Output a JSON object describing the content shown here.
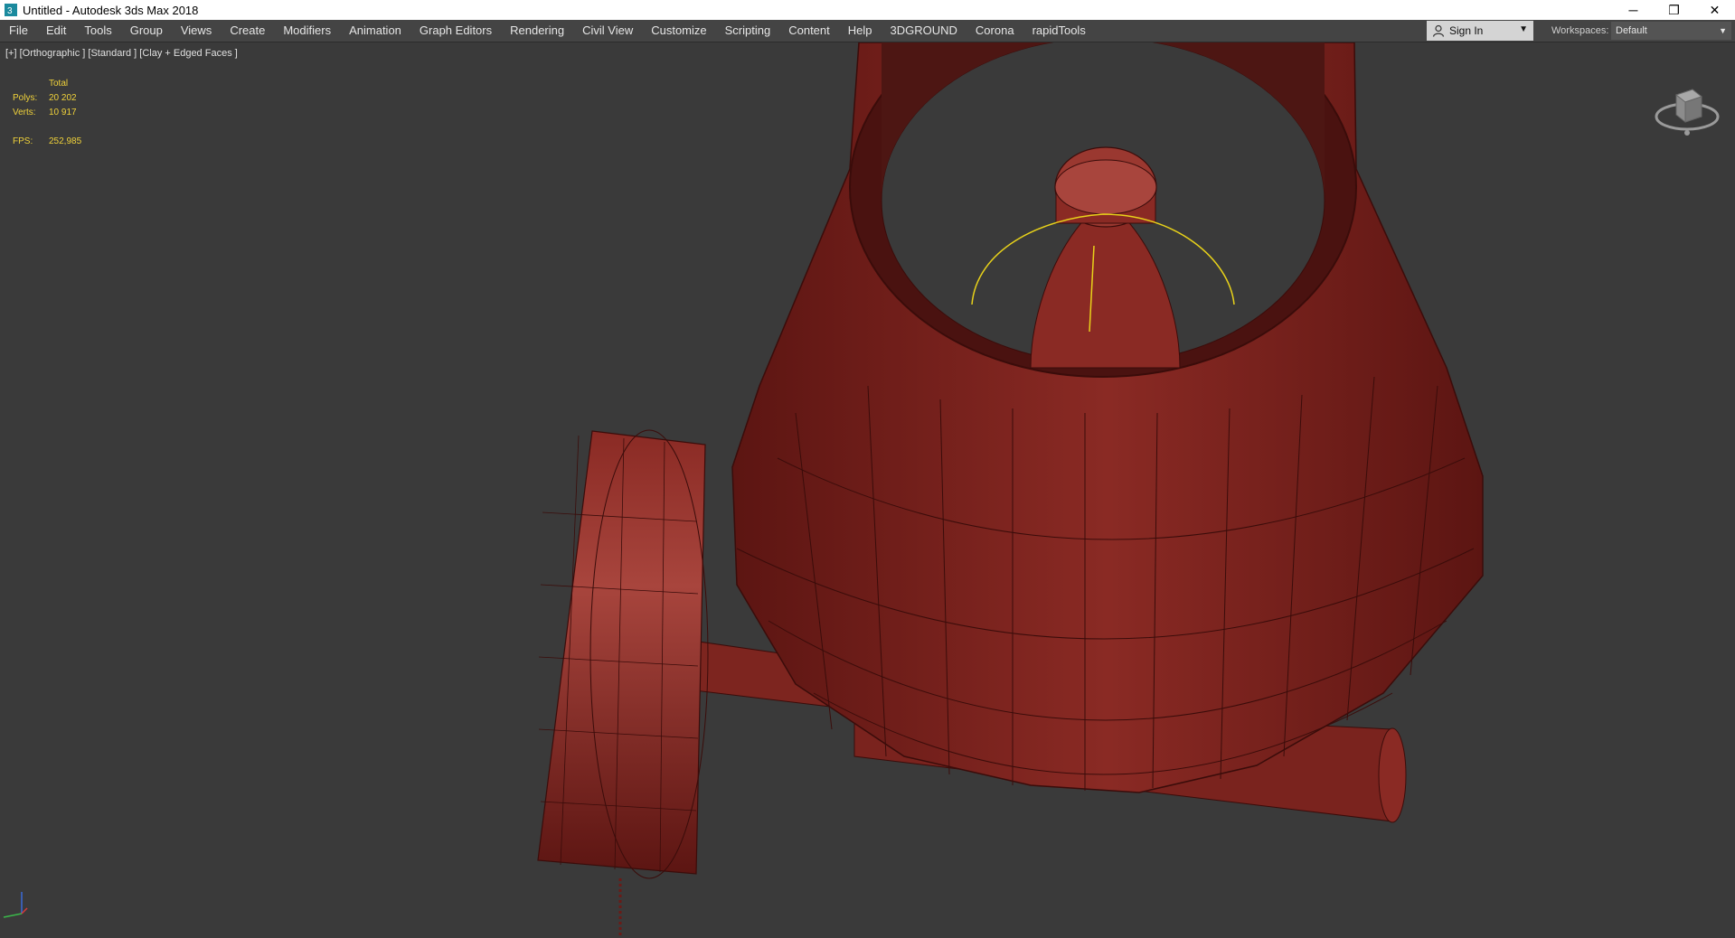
{
  "window": {
    "title": "Untitled - Autodesk 3ds Max 2018",
    "controls": {
      "minimize": "─",
      "restore": "❐",
      "close": "✕"
    }
  },
  "menu": {
    "items": [
      "File",
      "Edit",
      "Tools",
      "Group",
      "Views",
      "Create",
      "Modifiers",
      "Animation",
      "Graph Editors",
      "Rendering",
      "Civil View",
      "Customize",
      "Scripting",
      "Content",
      "Help",
      "3DGROUND",
      "Corona",
      "rapidTools"
    ],
    "signin_label": "Sign In",
    "workspaces_label": "Workspaces:",
    "workspace_value": "Default"
  },
  "viewport": {
    "label": "[+] [Orthographic ] [Standard ] [Clay + Edged Faces ]",
    "stats": {
      "header": "Total",
      "polys_label": "Polys:",
      "polys_value": "20 202",
      "verts_label": "Verts:",
      "verts_value": "10 917",
      "fps_label": "FPS:",
      "fps_value": "252,985"
    }
  },
  "colors": {
    "mesh": "#8a2a24",
    "mesh_dark": "#5c1512",
    "mesh_light": "#a8453d",
    "stat_text": "#f0d23a",
    "wire_highlight": "#e8d21a",
    "viewport_bg": "#3a3a3a"
  }
}
